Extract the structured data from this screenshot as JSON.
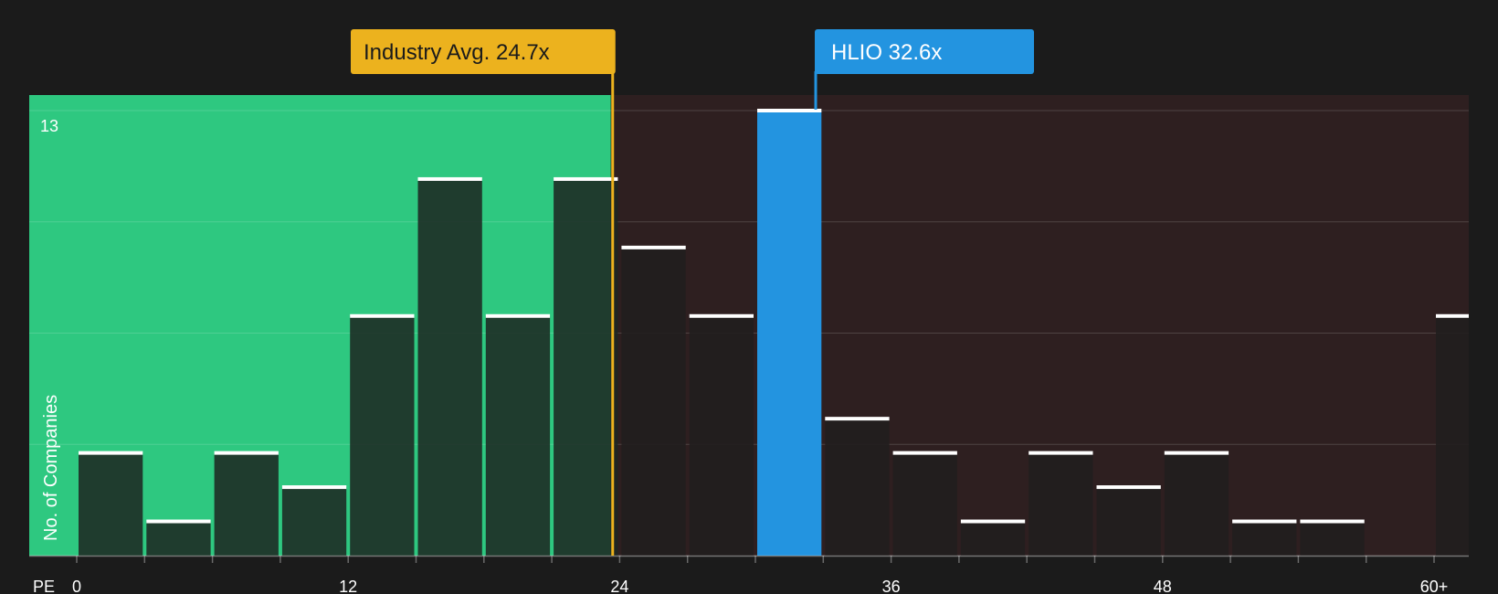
{
  "chart_data": {
    "type": "bar",
    "xlabel": "PE",
    "ylabel": "No. of Companies",
    "ylim": [
      0,
      13
    ],
    "y_max_label": "13",
    "x_ticks": [
      "0",
      "12",
      "24",
      "36",
      "48",
      "60+"
    ],
    "x_tick_values": [
      0,
      12,
      24,
      36,
      48,
      60
    ],
    "bin_width": 3,
    "bars": [
      {
        "start": 0,
        "value": 3
      },
      {
        "start": 3,
        "value": 1
      },
      {
        "start": 6,
        "value": 3
      },
      {
        "start": 9,
        "value": 2
      },
      {
        "start": 12,
        "value": 7
      },
      {
        "start": 15,
        "value": 11
      },
      {
        "start": 18,
        "value": 7
      },
      {
        "start": 21,
        "value": 11
      },
      {
        "start": 24,
        "value": 9
      },
      {
        "start": 27,
        "value": 7
      },
      {
        "start": 30,
        "value": 13,
        "highlight": true
      },
      {
        "start": 33,
        "value": 4
      },
      {
        "start": 36,
        "value": 3
      },
      {
        "start": 39,
        "value": 1
      },
      {
        "start": 42,
        "value": 3
      },
      {
        "start": 45,
        "value": 2
      },
      {
        "start": 48,
        "value": 3
      },
      {
        "start": 51,
        "value": 1
      },
      {
        "start": 54,
        "value": 1
      },
      {
        "start": 60,
        "value": 7
      }
    ],
    "industry_avg": {
      "label": "Industry Avg. 24.7x",
      "value": 24.7
    },
    "company": {
      "label": "HLIO 32.6x",
      "value": 32.6
    },
    "colors": {
      "background": "#1b1b1b",
      "below_avg_region": "#2ec880",
      "above_avg_region": "#2e1f20",
      "industry_badge": "#ecb21e",
      "company_badge": "#2394e0",
      "bar_cap": "#ffffff"
    }
  }
}
